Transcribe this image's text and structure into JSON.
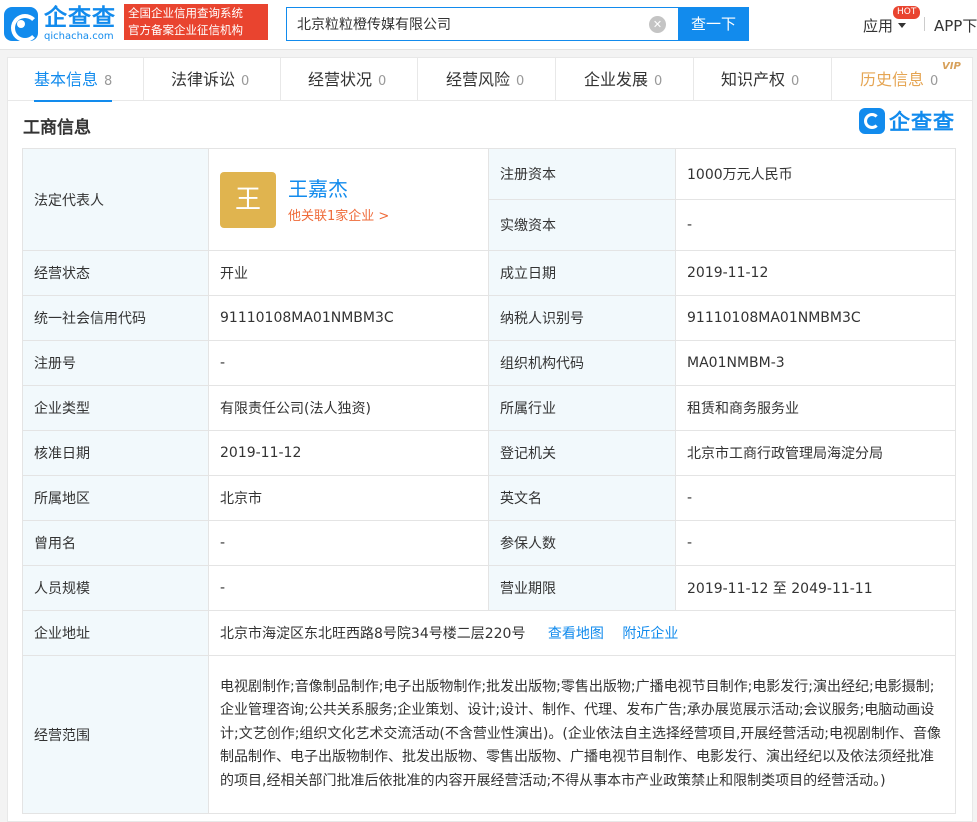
{
  "header": {
    "logo_cn": "企查查",
    "logo_en": "qichacha.com",
    "tag_line1": "全国企业信用查询系统",
    "tag_line2": "官方备案企业征信机构",
    "search_value": "北京粒粒橙传媒有限公司",
    "clear_icon": "✕",
    "search_button": "查一下",
    "app_menu": "应用",
    "hot_badge": "HOT",
    "app_download": "APP下"
  },
  "tabs": [
    {
      "label": "基本信息",
      "count": "8"
    },
    {
      "label": "法律诉讼",
      "count": "0"
    },
    {
      "label": "经营状况",
      "count": "0"
    },
    {
      "label": "经营风险",
      "count": "0"
    },
    {
      "label": "企业发展",
      "count": "0"
    },
    {
      "label": "知识产权",
      "count": "0"
    },
    {
      "label": "历史信息",
      "count": "0"
    }
  ],
  "vip_badge": "VIP",
  "section": {
    "title": "工商信息",
    "watermark": "企查查"
  },
  "legal": {
    "label": "法定代表人",
    "avatar": "王",
    "name": "王嘉杰",
    "link": "他关联1家企业 >"
  },
  "rows": {
    "reg_capital_label": "注册资本",
    "reg_capital": "1000万元人民币",
    "paid_capital_label": "实缴资本",
    "paid_capital": "-",
    "status_label": "经营状态",
    "status": "开业",
    "founded_label": "成立日期",
    "founded": "2019-11-12",
    "credit_code_label": "统一社会信用代码",
    "credit_code": "91110108MA01NMBM3C",
    "taxpayer_label": "纳税人识别号",
    "taxpayer": "91110108MA01NMBM3C",
    "reg_no_label": "注册号",
    "reg_no": "-",
    "org_code_label": "组织机构代码",
    "org_code": "MA01NMBM-3",
    "type_label": "企业类型",
    "type": "有限责任公司(法人独资)",
    "industry_label": "所属行业",
    "industry": "租赁和商务服务业",
    "approval_label": "核准日期",
    "approval": "2019-11-12",
    "authority_label": "登记机关",
    "authority": "北京市工商行政管理局海淀分局",
    "region_label": "所属地区",
    "region": "北京市",
    "english_label": "英文名",
    "english": "-",
    "former_label": "曾用名",
    "former": "-",
    "insured_label": "参保人数",
    "insured": "-",
    "staff_label": "人员规模",
    "staff": "-",
    "term_label": "营业期限",
    "term": "2019-11-12 至 2049-11-11",
    "address_label": "企业地址",
    "address": "北京市海淀区东北旺西路8号院34号楼二层220号",
    "map_link": "查看地图",
    "nearby_link": "附近企业",
    "scope_label": "经营范围",
    "scope": "电视剧制作;音像制品制作;电子出版物制作;批发出版物;零售出版物;广播电视节目制作;电影发行;演出经纪;电影摄制;企业管理咨询;公共关系服务;企业策划、设计;设计、制作、代理、发布广告;承办展览展示活动;会议服务;电脑动画设计;文艺创作;组织文化艺术交流活动(不含营业性演出)。(企业依法自主选择经营项目,开展经营活动;电视剧制作、音像制品制作、电子出版物制作、批发出版物、零售出版物、广播电视节目制作、电影发行、演出经纪以及依法须经批准的项目,经相关部门批准后依批准的内容开展经营活动;不得从事本市产业政策禁止和限制类项目的经营活动。)"
  }
}
